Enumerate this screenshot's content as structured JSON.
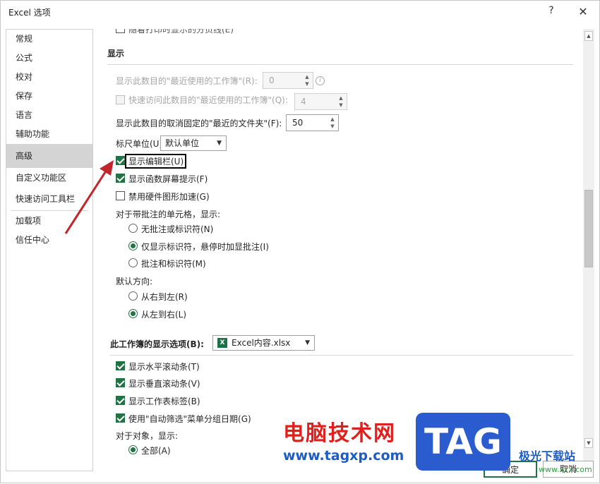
{
  "window": {
    "title": "Excel 选项",
    "help_icon": "?",
    "close_icon": "✕"
  },
  "sidebar": {
    "items": [
      {
        "label": "常规"
      },
      {
        "label": "公式"
      },
      {
        "label": "校对"
      },
      {
        "label": "保存"
      },
      {
        "label": "语言"
      },
      {
        "label": "辅助功能"
      },
      {
        "label": "高级",
        "selected": true
      },
      {
        "label": "自定义功能区"
      },
      {
        "label": "快速访问工具栏"
      },
      {
        "label": "加载项"
      },
      {
        "label": "信任中心"
      }
    ]
  },
  "display": {
    "cut_top_text": "随着打印时显示的分页线(E)",
    "section_title": "显示",
    "recent_workbooks_label": "显示此数目的\"最近使用的工作簿\"(R):",
    "recent_workbooks_value": "0",
    "quick_access_label": "快速访问此数目的\"最近使用的工作簿\"(Q):",
    "quick_access_value": "4",
    "unpinned_folders_label": "显示此数目的取消固定的\"最近的文件夹\"(F):",
    "unpinned_folders_value": "50",
    "ruler_units_label": "标尺单位(U)",
    "ruler_units_value": "默认单位",
    "show_formula_bar": "显示编辑栏(U)",
    "show_function_tooltips": "显示函数屏幕提示(F)",
    "disable_hw_accel": "禁用硬件图形加速(G)",
    "comments_label": "对于带批注的单元格，显示:",
    "comments_opt1": "无批注或标识符(N)",
    "comments_opt2": "仅显示标识符，悬停时加显批注(I)",
    "comments_opt3": "批注和标识符(M)",
    "direction_label": "默认方向:",
    "direction_rtl": "从右到左(R)",
    "direction_ltr": "从左到右(L)"
  },
  "workbook": {
    "section_title": "此工作簿的显示选项(B):",
    "file_name": "Excel内容.xlsx",
    "show_hscroll": "显示水平滚动条(T)",
    "show_vscroll": "显示垂直滚动条(V)",
    "show_sheet_tabs": "显示工作表标签(B)",
    "group_dates": "使用\"自动筛选\"菜单分组日期(G)",
    "objects_label": "对于对象，显示:",
    "objects_all": "全部(A)"
  },
  "buttons": {
    "ok": "确定",
    "cancel": "取消"
  },
  "watermark": {
    "cn": "电脑技术网",
    "url": "www.tagxp.com",
    "tag": "TAG",
    "site": "极光下载站",
    "site_url": "www.xz7.com"
  },
  "colors": {
    "accent": "#217346",
    "arrow": "#c0262c"
  }
}
